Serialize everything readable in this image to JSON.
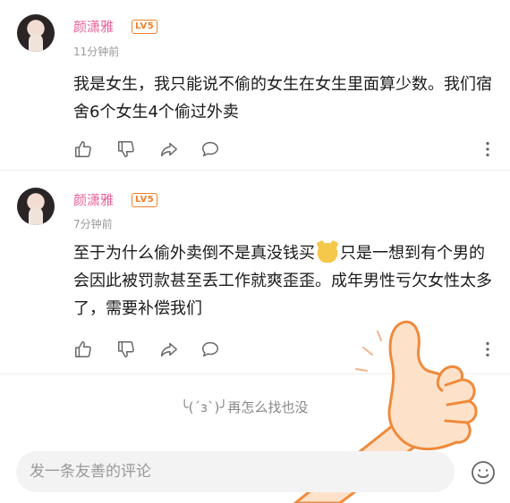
{
  "comments": [
    {
      "username": "颜潇雅",
      "level": "LV5",
      "time": "11分钟前",
      "text": "我是女生，我只能说不偷的女生在女生里面算少数。我们宿舍6个女生4个偷过外卖"
    },
    {
      "username": "颜潇雅",
      "level": "LV5",
      "time": "7分钟前",
      "text_before_emoji": "至于为什么偷外卖倒不是真没钱买",
      "emoji_name": "dog-emoji",
      "text_after_emoji": "只是一想到有个男的会因此被罚款甚至丢工作就爽歪歪。成年男性亏欠女性太多了，需要补偿我们"
    }
  ],
  "load_more_text": "╰(´з`)╯再怎么找也没",
  "input": {
    "placeholder": "发一条友善的评论"
  },
  "icons": {
    "like": "thumbs-up-icon",
    "dislike": "thumbs-down-icon",
    "share": "share-icon",
    "reply": "comment-bubble-icon",
    "more": "more-vertical-icon",
    "emoji": "smiley-icon",
    "overlay": "thumbs-up-hand-icon"
  },
  "colors": {
    "username": "#e8629a",
    "level_badge": "#f0802c",
    "meta": "#999999",
    "hand_skin": "#fde2c9",
    "hand_outline": "#ef8a3c"
  }
}
